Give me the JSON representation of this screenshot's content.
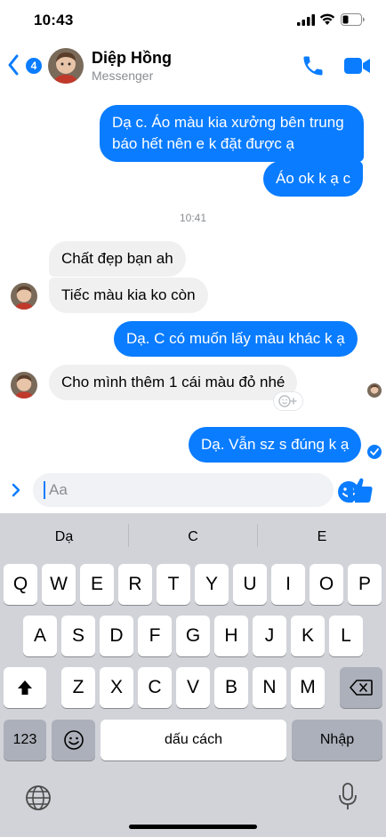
{
  "status_bar": {
    "time": "10:43"
  },
  "header": {
    "back_badge": "4",
    "contact_name": "Diệp Hồng",
    "contact_subtitle": "Messenger"
  },
  "messages": [
    {
      "direction": "out",
      "text_lines": [
        "Dạ c. Áo màu kia xưởng bên trung",
        "báo hết nên e k đặt được ạ"
      ]
    },
    {
      "direction": "out",
      "text": "Áo ok k ạ c"
    },
    {
      "type": "timestamp",
      "text": "10:41"
    },
    {
      "direction": "in",
      "text": "Chất đẹp bạn ah"
    },
    {
      "direction": "in",
      "text": "Tiếc màu kia ko còn"
    },
    {
      "direction": "out",
      "text": "Dạ. C có muốn lấy màu khác k ạ"
    },
    {
      "direction": "in",
      "text": "Cho mình thêm 1 cái màu đỏ nhé"
    },
    {
      "direction": "out",
      "text": "Dạ. Vẫn sz s đúng k ạ"
    }
  ],
  "composer": {
    "placeholder": "Aa"
  },
  "keyboard": {
    "suggestions": [
      "Dạ",
      "C",
      "E"
    ],
    "row1": [
      "Q",
      "W",
      "E",
      "R",
      "T",
      "Y",
      "U",
      "I",
      "O",
      "P"
    ],
    "row2": [
      "A",
      "S",
      "D",
      "F",
      "G",
      "H",
      "J",
      "K",
      "L"
    ],
    "row3": [
      "Z",
      "X",
      "C",
      "V",
      "B",
      "N",
      "M"
    ],
    "numbers_key": "123",
    "space_key": "dấu cách",
    "return_key": "Nhập"
  },
  "colors": {
    "accent": "#0a7cff",
    "incoming_bubble": "#f0f0f0",
    "keyboard_bg": "#d1d3d9"
  },
  "icons": [
    "signal-icon",
    "wifi-icon",
    "battery-icon",
    "back-chevron-icon",
    "phone-icon",
    "video-icon",
    "expand-chevron-icon",
    "emoji-icon",
    "like-thumb-icon",
    "shift-icon",
    "backspace-icon",
    "keyboard-emoji-icon",
    "globe-icon",
    "microphone-icon",
    "add-reaction-icon",
    "check-icon"
  ]
}
